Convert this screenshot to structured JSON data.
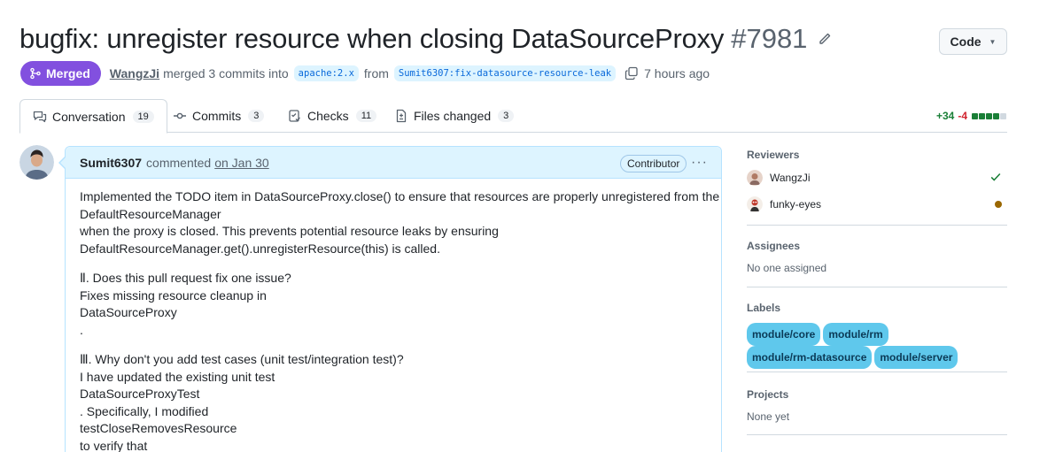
{
  "header": {
    "title": "bugfix: unregister resource when closing DataSourceProxy",
    "number": "#7981",
    "code_button": "Code"
  },
  "meta": {
    "status": "Merged",
    "author": "WangzJi",
    "merged_text": "merged 3 commits into",
    "base_branch": "apache:2.x",
    "from_text": "from",
    "head_branch": "Sumit6307:fix-datasource-resource-leak",
    "time": "7 hours ago"
  },
  "tabs": [
    {
      "label": "Conversation",
      "count": "19",
      "icon": "comment-discussion-icon"
    },
    {
      "label": "Commits",
      "count": "3",
      "icon": "git-commit-icon"
    },
    {
      "label": "Checks",
      "count": "11",
      "icon": "checklist-icon"
    },
    {
      "label": "Files changed",
      "count": "3",
      "icon": "file-diff-icon"
    }
  ],
  "diffstat": {
    "additions": "+34",
    "deletions": "-4",
    "green_blocks": 4,
    "neutral_blocks": 1
  },
  "comment": {
    "author": "Sumit6307",
    "action": "commented",
    "date": "on Jan 30",
    "badge": "Contributor",
    "lines": [
      "Implemented the TODO item in DataSourceProxy.close() to ensure that resources are properly unregistered from the",
      "DefaultResourceManager",
      "when the proxy is closed. This prevents potential resource leaks by ensuring",
      "DefaultResourceManager.get().unregisterResource(this) is called.",
      "",
      "Ⅱ. Does this pull request fix one issue?",
      "Fixes missing resource cleanup in",
      "DataSourceProxy",
      ".",
      "",
      "Ⅲ. Why don't you add test cases (unit test/integration test)?",
      "I have updated the existing unit test",
      "DataSourceProxyTest",
      ". Specifically, I modified",
      "testCloseRemovesResource",
      "to verify that"
    ]
  },
  "sidebar": {
    "reviewers_heading": "Reviewers",
    "reviewers": [
      {
        "name": "WangzJi",
        "status": "approved",
        "status_color": "#1a7f37"
      },
      {
        "name": "funky-eyes",
        "status": "pending",
        "status_color": "#9a6700"
      }
    ],
    "assignees_heading": "Assignees",
    "assignees_text": "No one assigned",
    "labels_heading": "Labels",
    "labels": [
      "module/core",
      "module/rm",
      "module/rm-datasource",
      "module/server"
    ],
    "projects_heading": "Projects",
    "projects_text": "None yet"
  },
  "colors": {
    "merged": "#8250df",
    "accent": "#0969da",
    "label_bg": "#5fc8ec"
  }
}
